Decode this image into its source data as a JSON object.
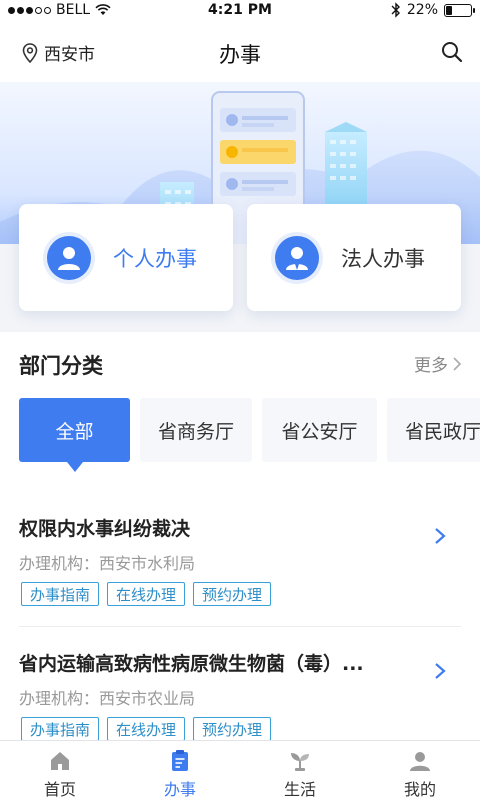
{
  "status_bar": {
    "carrier": "BELL",
    "time": "4:21 PM",
    "battery": "22%",
    "battery_level": 0.22
  },
  "nav": {
    "location": "西安市",
    "title": "办事"
  },
  "cards": [
    {
      "label": "个人办事",
      "icon": "person-icon"
    },
    {
      "label": "法人办事",
      "icon": "business-person-icon"
    }
  ],
  "section": {
    "title": "部门分类",
    "more": "更多"
  },
  "dept_tabs": [
    {
      "label": "全部"
    },
    {
      "label": "省商务厅"
    },
    {
      "label": "省公安厅"
    },
    {
      "label": "省民政厅"
    }
  ],
  "services": [
    {
      "title": "权限内水事纠纷裁决",
      "org": "办理机构：西安市水利局",
      "tags": [
        "办事指南",
        "在线办理",
        "预约办理"
      ]
    },
    {
      "title": "省内运输高致病性病原微生物菌（毒）...",
      "org": "办理机构：西安市农业局",
      "tags": [
        "办事指南",
        "在线办理",
        "预约办理"
      ]
    }
  ],
  "tab_bar": [
    {
      "label": "首页",
      "icon": "home-icon"
    },
    {
      "label": "办事",
      "icon": "service-icon"
    },
    {
      "label": "生活",
      "icon": "life-icon"
    },
    {
      "label": "我的",
      "icon": "profile-icon"
    }
  ],
  "colors": {
    "primary": "#3f7cf0",
    "tag_blue": "#2f8fc8",
    "text_dark": "#222222",
    "text_gray": "#999999"
  }
}
